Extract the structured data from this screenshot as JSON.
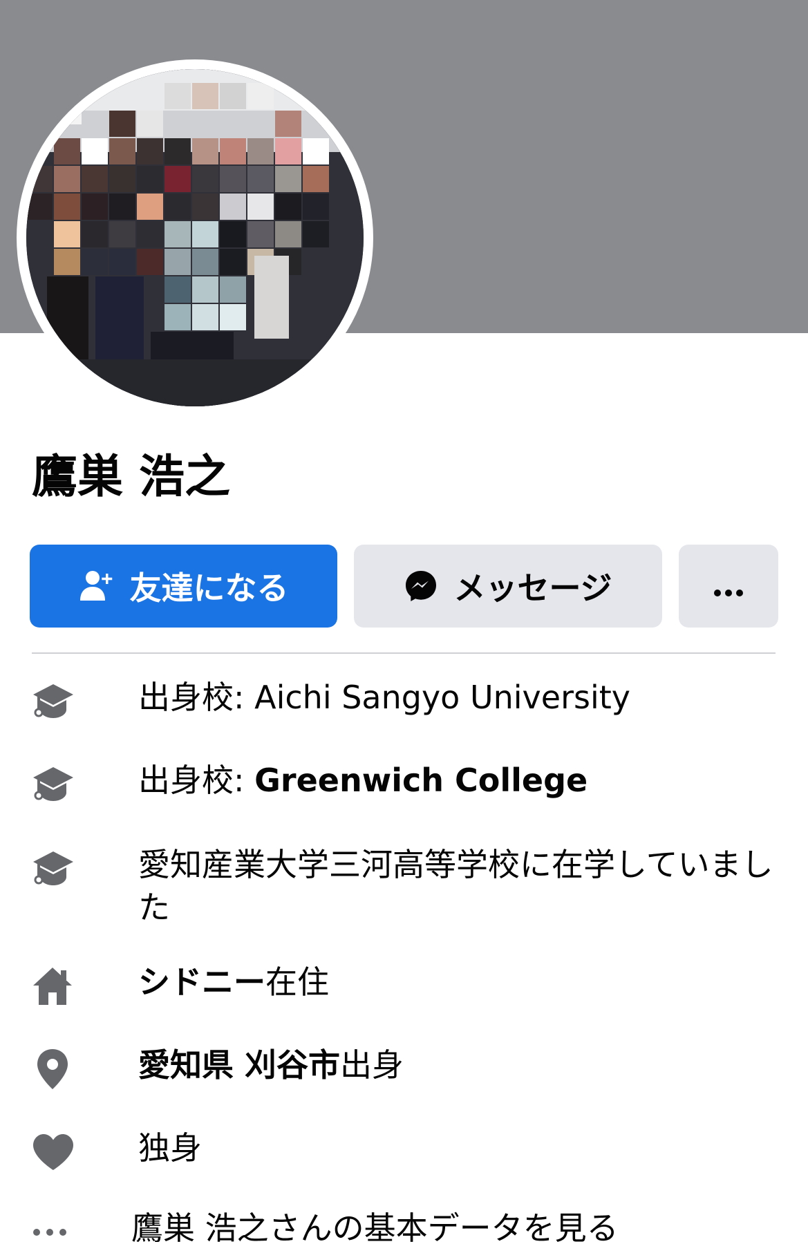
{
  "profile": {
    "name": "鷹巣 浩之"
  },
  "actions": {
    "add_friend_label": "友達になる",
    "message_label": "メッセージ",
    "more_label": "···"
  },
  "intro": {
    "education_1": {
      "prefix": "出身校: ",
      "value": "Aichi Sangyo University"
    },
    "education_2": {
      "prefix": "出身校: ",
      "value": "Greenwich College"
    },
    "education_3": {
      "text": "愛知産業大学三河高等学校に在学していました"
    },
    "current_city": {
      "value": "シドニー",
      "suffix": "在住"
    },
    "hometown": {
      "value": "愛知県 刈谷市",
      "suffix": "出身"
    },
    "relationship": {
      "text": "独身"
    },
    "see_about": {
      "text": "鷹巣 浩之さんの基本データを見る"
    }
  },
  "icons": {
    "education": "graduation-cap-icon",
    "current_city": "home-icon",
    "hometown": "location-pin-icon",
    "relationship": "heart-icon",
    "see_about": "ellipsis-icon",
    "add_friend": "add-friend-icon",
    "message": "messenger-icon"
  },
  "colors": {
    "primary": "#1b74e4",
    "secondary_button": "#e4e6eb",
    "cover": "#8a8b8f",
    "icon_gray": "#65676b",
    "text": "#050505"
  }
}
